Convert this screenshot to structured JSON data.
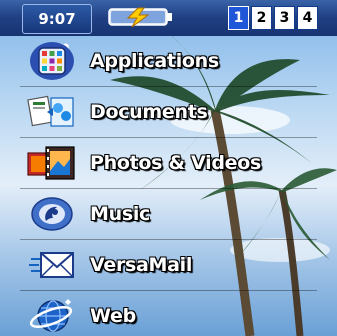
{
  "status": {
    "time": "9:07 am",
    "battery_icon": "battery-charging-icon",
    "pages": [
      "1",
      "2",
      "3",
      "4"
    ],
    "active_page": "1"
  },
  "menu": {
    "items": [
      {
        "label": "Applications",
        "icon": "applications-icon"
      },
      {
        "label": "Documents",
        "icon": "documents-icon"
      },
      {
        "label": "Photos & Videos",
        "icon": "photos-videos-icon"
      },
      {
        "label": "Music",
        "icon": "music-icon"
      },
      {
        "label": "VersaMail",
        "icon": "versamail-icon"
      },
      {
        "label": "Web",
        "icon": "web-icon"
      }
    ]
  },
  "colors": {
    "statusbar": "#1f3f82",
    "active_page": "#1f57d8",
    "sky": "#7fb4e8"
  }
}
